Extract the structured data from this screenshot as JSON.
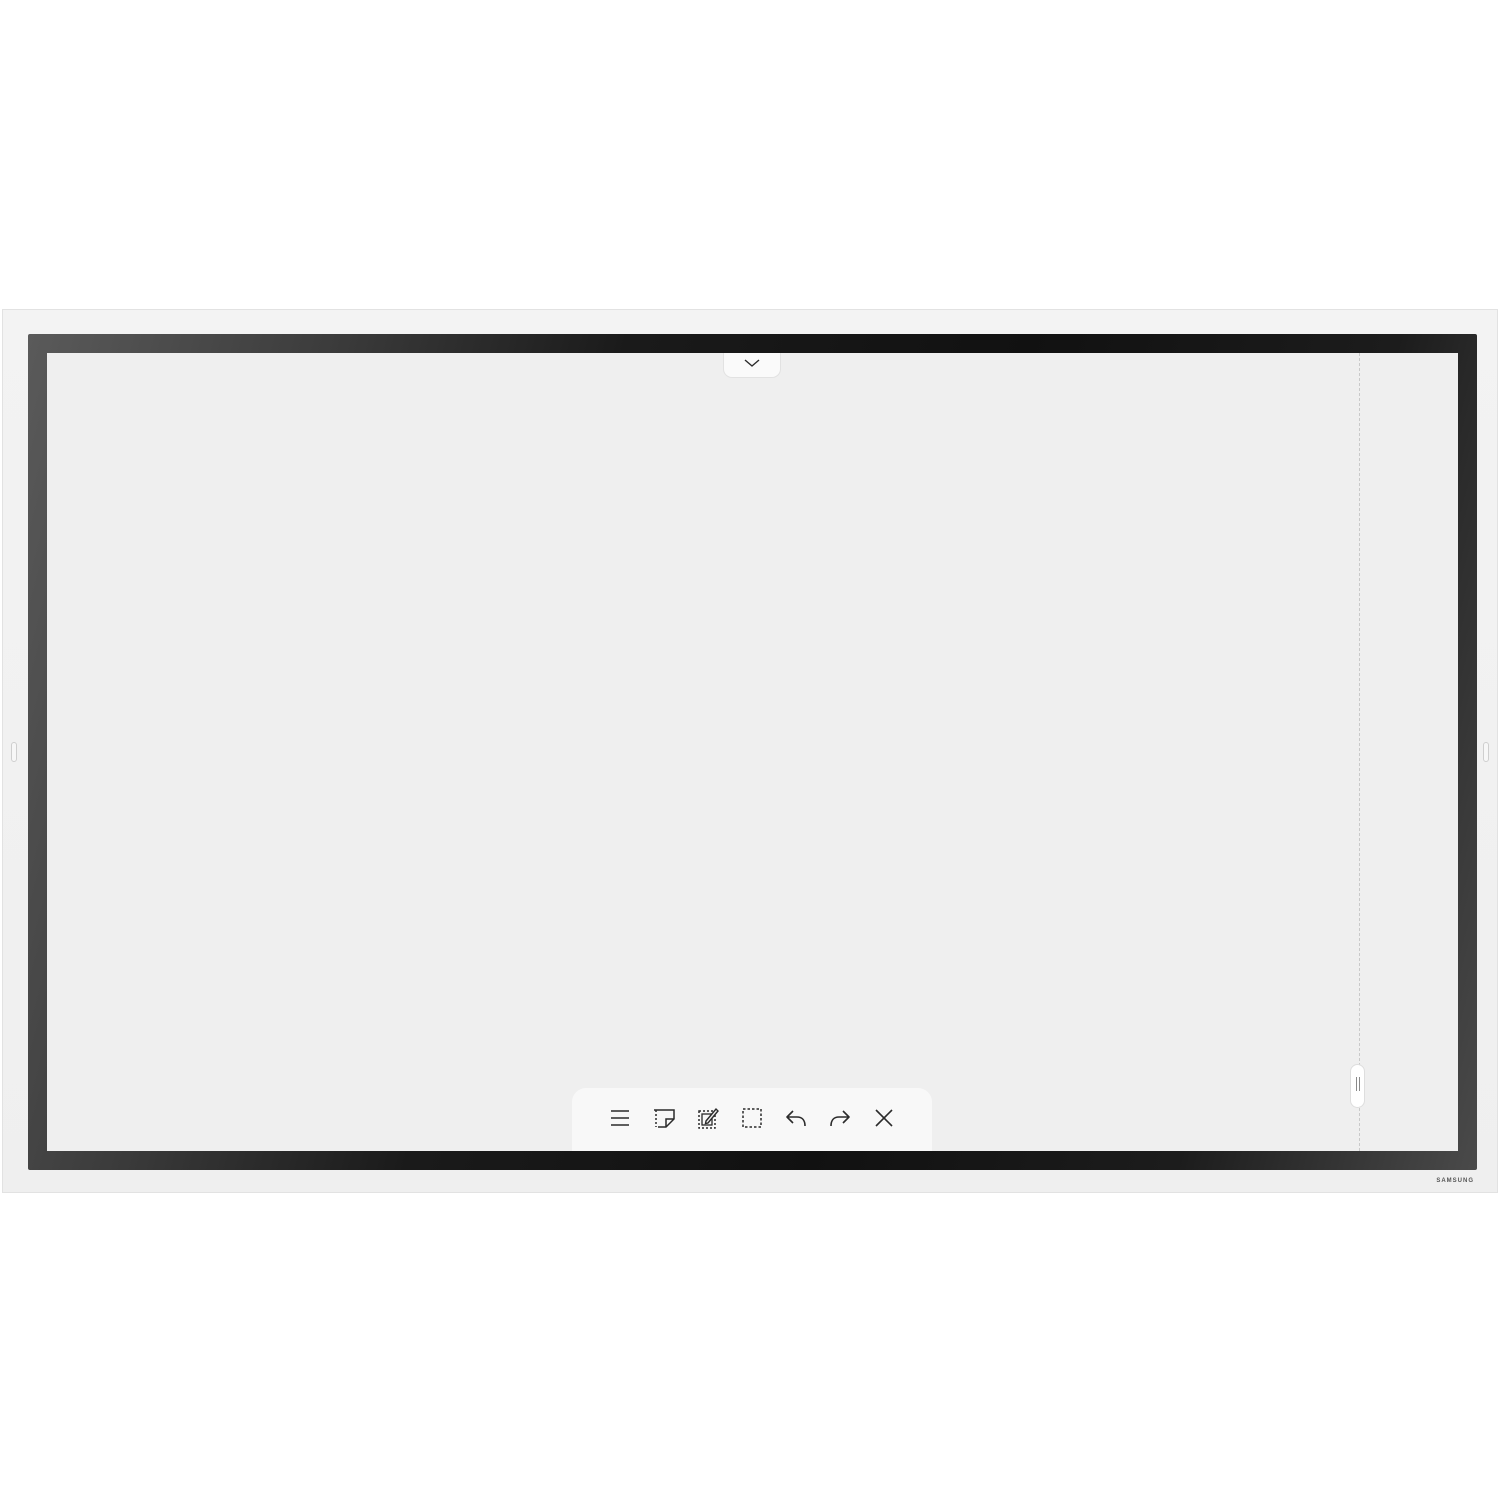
{
  "device": {
    "brand": "SAMSUNG"
  },
  "toolbar": {
    "items": [
      {
        "name": "menu",
        "icon": "menu-icon"
      },
      {
        "name": "sticky-note",
        "icon": "sticky-note-icon"
      },
      {
        "name": "edit-note",
        "icon": "edit-note-icon"
      },
      {
        "name": "select-area",
        "icon": "select-area-icon"
      },
      {
        "name": "undo",
        "icon": "undo-icon"
      },
      {
        "name": "redo",
        "icon": "redo-icon"
      },
      {
        "name": "close",
        "icon": "close-icon"
      }
    ]
  },
  "top_tab": {
    "icon": "chevron-down-icon"
  },
  "scroll_handle": {
    "icon": "grip-icon"
  },
  "colors": {
    "screen_background": "#efefef",
    "toolbar_background": "#f8f8f8",
    "icon_stroke": "#2b2b2b",
    "bezel": "#111111"
  }
}
